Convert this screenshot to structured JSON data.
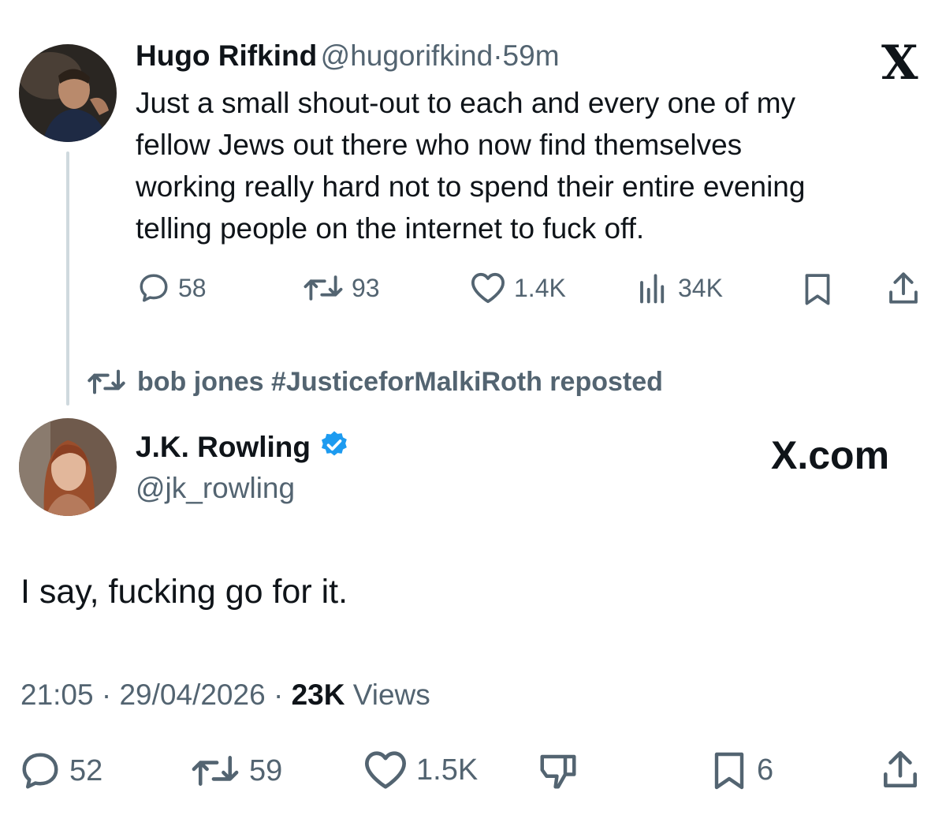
{
  "original": {
    "author_name": "Hugo Rifkind",
    "handle": "@hugorifkind",
    "separator": "·",
    "time": "59m",
    "text_lines": [
      "Just a small shout-out to each and every one of my",
      "fellow Jews out there who now find themselves",
      "working really hard not to spend their entire evening",
      "telling people on the internet to fuck off."
    ],
    "replies": "58",
    "reposts": "93",
    "likes": "1.4K",
    "views": "34K"
  },
  "repost_notice": "bob jones #JusticeforMalkiRoth reposted",
  "main": {
    "author_name": "J.K. Rowling",
    "handle": "@jk_rowling",
    "text": "I say, fucking go for it.",
    "time": "21:05",
    "sep1": "·",
    "date": "29/04/2026",
    "sep2": "·",
    "views_count": "23K",
    "views_label": "Views",
    "replies": "52",
    "reposts": "59",
    "likes": "1.5K",
    "bookmarks": "6"
  },
  "watermark": {
    "x_logo": "X",
    "x_com": "X.com"
  },
  "colors": {
    "text": "#0f1419",
    "secondary": "#536471",
    "verified": "#1d9bf0",
    "thread_line": "#cfd9de"
  },
  "icons": [
    "reply-icon",
    "repost-icon",
    "like-icon",
    "views-icon",
    "bookmark-icon",
    "share-icon",
    "dislike-icon",
    "verified-badge-icon",
    "x-logo-icon"
  ]
}
